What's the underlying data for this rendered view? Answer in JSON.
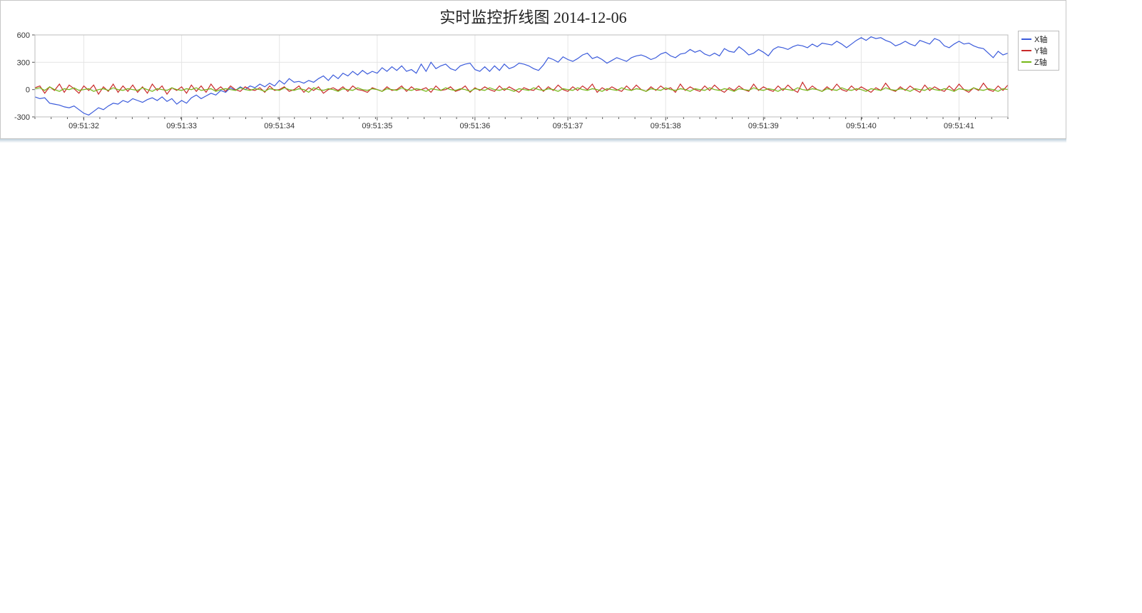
{
  "chart_data": {
    "type": "line",
    "title": "实时监控折线图 2014-12-06",
    "xlabel": "",
    "ylabel": "",
    "ylim": [
      -300,
      600
    ],
    "y_ticks": [
      -300,
      0,
      300,
      600
    ],
    "x_tick_labels": [
      "09:51:32",
      "09:51:33",
      "09:51:34",
      "09:51:35",
      "09:51:36",
      "09:51:37",
      "09:51:38",
      "09:51:39",
      "09:51:40",
      "09:51:41"
    ],
    "x_step_seconds": 1,
    "legend": [
      "X轴",
      "Y轴",
      "Z轴"
    ],
    "series": [
      {
        "name": "X轴",
        "color": "#3b5bdb",
        "values": [
          -80,
          -100,
          -90,
          -150,
          -160,
          -170,
          -190,
          -200,
          -180,
          -220,
          -260,
          -280,
          -240,
          -200,
          -220,
          -180,
          -150,
          -160,
          -120,
          -140,
          -100,
          -120,
          -140,
          -110,
          -90,
          -120,
          -80,
          -130,
          -100,
          -160,
          -120,
          -150,
          -90,
          -60,
          -100,
          -70,
          -40,
          -60,
          -10,
          -30,
          20,
          -10,
          30,
          0,
          40,
          20,
          60,
          30,
          70,
          40,
          100,
          60,
          120,
          80,
          90,
          70,
          100,
          80,
          120,
          150,
          100,
          160,
          120,
          180,
          150,
          200,
          160,
          210,
          170,
          200,
          180,
          240,
          200,
          250,
          210,
          260,
          200,
          220,
          180,
          280,
          200,
          300,
          230,
          260,
          280,
          230,
          210,
          260,
          280,
          290,
          220,
          200,
          250,
          200,
          260,
          210,
          280,
          230,
          250,
          290,
          280,
          260,
          230,
          210,
          270,
          350,
          330,
          300,
          360,
          330,
          310,
          340,
          380,
          400,
          340,
          360,
          330,
          290,
          320,
          350,
          330,
          310,
          350,
          370,
          380,
          360,
          330,
          350,
          390,
          410,
          370,
          350,
          390,
          400,
          440,
          410,
          430,
          390,
          370,
          400,
          370,
          450,
          420,
          410,
          470,
          430,
          380,
          400,
          440,
          410,
          370,
          440,
          470,
          460,
          440,
          470,
          490,
          480,
          460,
          500,
          470,
          510,
          500,
          490,
          530,
          500,
          460,
          500,
          540,
          570,
          540,
          580,
          560,
          570,
          540,
          520,
          480,
          500,
          530,
          500,
          480,
          540,
          520,
          500,
          560,
          540,
          480,
          460,
          500,
          530,
          500,
          510,
          480,
          460,
          450,
          400,
          350,
          420,
          380,
          400
        ]
      },
      {
        "name": "Y轴",
        "color": "#c92a2a",
        "values": [
          20,
          40,
          -40,
          30,
          -10,
          60,
          -30,
          50,
          10,
          -40,
          40,
          -10,
          50,
          -50,
          30,
          -20,
          60,
          -30,
          40,
          -20,
          50,
          -30,
          30,
          -40,
          60,
          -10,
          40,
          -50,
          20,
          -10,
          30,
          -40,
          50,
          -20,
          40,
          -30,
          60,
          -10,
          30,
          -20,
          40,
          0,
          -20,
          30,
          0,
          -10,
          20,
          -30,
          40,
          -10,
          0,
          30,
          -20,
          0,
          40,
          -30,
          20,
          -10,
          30,
          -40,
          0,
          20,
          -10,
          30,
          -20,
          40,
          0,
          -10,
          -30,
          20,
          0,
          -20,
          30,
          -10,
          0,
          40,
          -20,
          30,
          -10,
          0,
          20,
          -30,
          40,
          -10,
          0,
          30,
          -20,
          0,
          40,
          -30,
          20,
          -10,
          30,
          0,
          -20,
          40,
          -10,
          30,
          0,
          -30,
          20,
          0,
          -10,
          40,
          -20,
          30,
          -10,
          50,
          0,
          -20,
          30,
          -10,
          40,
          0,
          60,
          -30,
          20,
          -10,
          30,
          0,
          -20,
          40,
          -10,
          50,
          0,
          -20,
          30,
          -10,
          40,
          0,
          20,
          -30,
          60,
          -10,
          30,
          0,
          -20,
          40,
          -10,
          50,
          0,
          -30,
          20,
          -10,
          40,
          0,
          -20,
          60,
          -10,
          30,
          0,
          -20,
          40,
          -10,
          50,
          0,
          -30,
          80,
          -10,
          40,
          0,
          -20,
          30,
          -10,
          60,
          0,
          -20,
          40,
          -10,
          30,
          0,
          -30,
          20,
          -10,
          70,
          0,
          -20,
          30,
          -10,
          40,
          0,
          -30,
          50,
          -10,
          30,
          0,
          -20,
          40,
          -10,
          60,
          0,
          -30,
          20,
          -10,
          70,
          0,
          -20,
          40,
          -10,
          50
        ]
      },
      {
        "name": "Z轴",
        "color": "#74b816",
        "values": [
          10,
          20,
          -10,
          30,
          0,
          -20,
          10,
          0,
          20,
          -10,
          0,
          10,
          -20,
          0,
          10,
          -10,
          20,
          0,
          -10,
          10,
          0,
          -10,
          20,
          0,
          -20,
          10,
          0,
          -10,
          20,
          0,
          -10,
          10,
          0,
          20,
          -10,
          0,
          10,
          -20,
          0,
          10,
          0,
          -10,
          20,
          0,
          -10,
          10,
          0,
          -20,
          10,
          0,
          -10,
          20,
          0,
          -10,
          10,
          0,
          -30,
          20,
          0,
          -10,
          10,
          0,
          -20,
          10,
          0,
          -10,
          20,
          0,
          -10,
          10,
          0,
          -20,
          10,
          0,
          -10,
          20,
          0,
          -10,
          10,
          0,
          -20,
          10,
          0,
          -10,
          20,
          0,
          -10,
          10,
          0,
          -20,
          10,
          0,
          -10,
          20,
          0,
          -10,
          10,
          0,
          -20,
          10,
          0,
          -10,
          20,
          0,
          -10,
          10,
          0,
          -20,
          10,
          0,
          -10,
          20,
          0,
          -10,
          10,
          0,
          -20,
          10,
          0,
          -10,
          20,
          0,
          -10,
          10,
          0,
          -20,
          10,
          0,
          -10,
          20,
          0,
          -10,
          10,
          0,
          -20,
          10,
          0,
          -10,
          20,
          0,
          -10,
          10,
          0,
          -20,
          10,
          0,
          -10,
          20,
          0,
          -10,
          10,
          0,
          -20,
          10,
          0,
          -10,
          20,
          0,
          -10,
          10,
          0,
          -20,
          10,
          0,
          -10,
          20,
          0,
          -10,
          10,
          0,
          -20,
          10,
          0,
          -10,
          20,
          0,
          -10,
          10,
          0,
          -20,
          10,
          0,
          -10,
          20,
          0,
          -10,
          10,
          0,
          -20,
          10,
          0,
          -10,
          20,
          0,
          -10,
          10,
          0,
          -20,
          10,
          0
        ]
      }
    ]
  }
}
